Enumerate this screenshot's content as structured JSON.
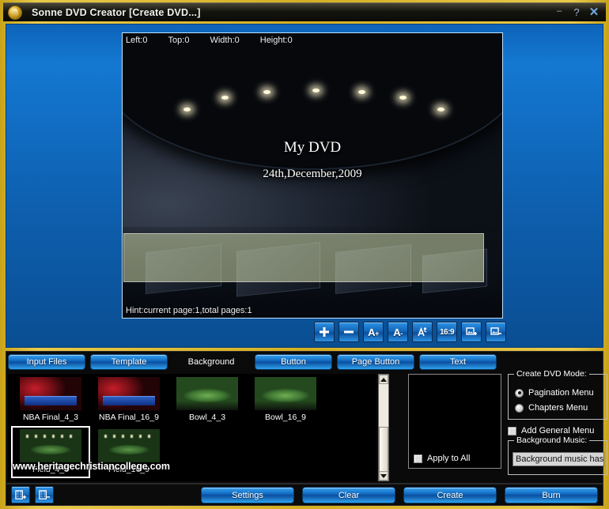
{
  "window": {
    "title": "Sonne DVD Creator [Create DVD...]",
    "app_icon": "sonne-logo-icon",
    "controls": {
      "minimize": "–",
      "help": "?",
      "close": "✕"
    }
  },
  "preview": {
    "coords": {
      "left": "Left:0",
      "top": "Top:0",
      "width": "Width:0",
      "height": "Height:0"
    },
    "hint": "Hint:current page:1,total pages:1",
    "menu_title": "My DVD",
    "menu_date": "24th,December,2009"
  },
  "preview_toolbar": [
    {
      "name": "add-item-button",
      "label": "+",
      "icon": "plus-icon"
    },
    {
      "name": "remove-item-button",
      "label": "–",
      "icon": "minus-icon"
    },
    {
      "name": "increase-font-button",
      "label": "A+",
      "icon": "font-increase-icon"
    },
    {
      "name": "decrease-font-button",
      "label": "A-",
      "icon": "font-decrease-icon"
    },
    {
      "name": "text-effect-button",
      "label": "",
      "icon": "text-effect-icon"
    },
    {
      "name": "aspect-ratio-button",
      "label": "16:9",
      "icon": "aspect-ratio-icon"
    },
    {
      "name": "image-add-button",
      "label": "",
      "icon": "image-plus-icon"
    },
    {
      "name": "image-remove-button",
      "label": "",
      "icon": "image-minus-icon"
    }
  ],
  "tabs": [
    {
      "label": "Input Files",
      "active": false
    },
    {
      "label": "Template",
      "active": false
    },
    {
      "label": "Background",
      "active": true
    },
    {
      "label": "Button",
      "active": false
    },
    {
      "label": "Page Button",
      "active": false
    },
    {
      "label": "Text",
      "active": false
    }
  ],
  "thumbnails": [
    {
      "label": "NBA Final_4_3",
      "style": "img-nba",
      "selected": false
    },
    {
      "label": "NBA Final_16_9",
      "style": "img-nba",
      "selected": false
    },
    {
      "label": "Bowl_4_3",
      "style": "img-bowl",
      "selected": false
    },
    {
      "label": "Bowl_16_9",
      "style": "img-bowl",
      "selected": false
    },
    {
      "label": "Field_4_3",
      "style": "img-field",
      "selected": true
    },
    {
      "label": "Field_16_9",
      "style": "img-field",
      "selected": false
    }
  ],
  "watermark": "www.heritagechristiancollege.com",
  "apply_to_all": {
    "label": "Apply to All",
    "checked": false
  },
  "create_mode": {
    "title": "Create DVD Mode:",
    "options": [
      {
        "label": "Pagination Menu",
        "selected": true
      },
      {
        "label": "Chapters Menu",
        "selected": false
      }
    ]
  },
  "add_general_menu": {
    "label": "Add General Menu",
    "checked": false
  },
  "background_music": {
    "title": "Background Music:",
    "value": "Background music has not been set",
    "placeholder": "Background music has not been set"
  },
  "page_buttons": [
    {
      "name": "add-page-button",
      "icon": "film-plus-icon"
    },
    {
      "name": "remove-page-button",
      "icon": "film-minus-icon"
    }
  ],
  "actions": [
    {
      "label": "Settings",
      "name": "settings-button"
    },
    {
      "label": "Clear",
      "name": "clear-button"
    },
    {
      "label": "Create",
      "name": "create-button"
    },
    {
      "label": "Burn",
      "name": "burn-button"
    }
  ],
  "colors": {
    "window_frame": "#d8b018",
    "panel_blue": "#0e60b0",
    "button_blue": "#1470c6",
    "dark_bg": "#0a0a0a"
  }
}
